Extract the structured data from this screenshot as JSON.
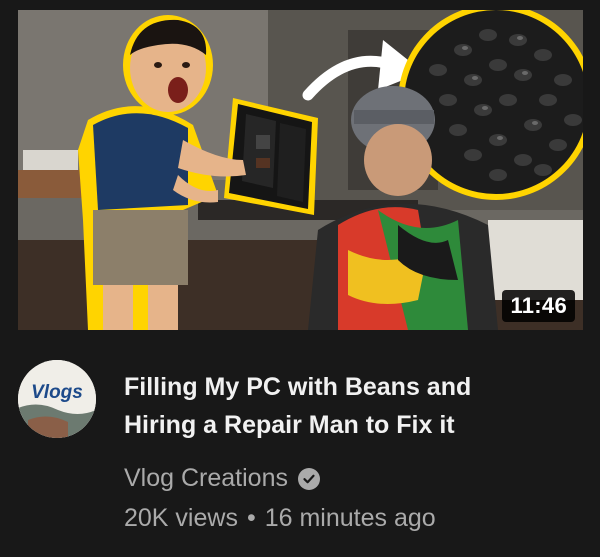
{
  "video": {
    "duration": "11:46",
    "title_line1": "Filling My PC with Beans and",
    "title_line2": "Hiring a Repair Man to Fix it",
    "views": "20K views",
    "separator": "•",
    "uploaded": "16 minutes ago"
  },
  "channel": {
    "name": "Vlog Creations",
    "avatar_text": "Vlogs",
    "verified_icon": "check-circle-icon"
  },
  "colors": {
    "background": "#181818",
    "title": "#f1f1f1",
    "meta": "#aaaaaa",
    "highlight_outline": "#ffd400"
  }
}
